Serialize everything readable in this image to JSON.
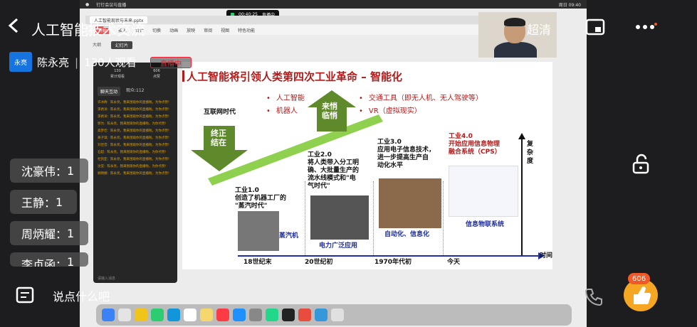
{
  "header": {
    "title": "人工智能技术交流",
    "quality": "超清"
  },
  "host": {
    "avatar_text": "永亮",
    "name": "陈永亮",
    "viewers": "130人观看",
    "live_badge": "直播中"
  },
  "ranking": [
    {
      "name": "沈豪伟",
      "count": "1"
    },
    {
      "name": "王静",
      "count": "1"
    },
    {
      "name": "周炳耀",
      "count": "1"
    },
    {
      "name": "李贞函",
      "count": "1"
    }
  ],
  "bottom": {
    "say_placeholder": "说点什么吧",
    "like_count": "606"
  },
  "mac": {
    "app_name": "钉钉会议与直播",
    "clock": "周日 09:40",
    "rec_time": "00:40:25",
    "rec_label": "直播中",
    "ppt_file": "人工智能现状与未来.pptx",
    "ribbon": [
      "开始",
      "插入",
      "设计",
      "切换",
      "动画",
      "放映",
      "审阅",
      "视图",
      "特色功能"
    ],
    "subbar": [
      "大纲",
      "幻灯片"
    ]
  },
  "panel": {
    "stat1_value": "130",
    "stat1_label": "累计观看",
    "stat2_value": "606",
    "stat2_label": "点赞",
    "tab1": "聊天互动",
    "tab2": "观众:112",
    "messages": [
      "许冰倩：陈永亮，我来围观你的直播啦，为你点赞!",
      "李君洋：陈永亮，我来围观你的直播啦，为你点赞!",
      "李君洋：陈永亮，我来围观你的直播啦，为你点赞!",
      "郭为：陈永亮，我来围观你的直播啦，为你点赞!",
      "高梦佳：陈永亮，我来围观你的直播啦，为你点赞!",
      "黄子琪：陈永亮，我来围观你的直播啦，为你点赞!",
      "刘佳音：陈永亮，我来围观你的直播啦，为你点赞!",
      "石超：陈永亮，我来围观你的直播啦，为你点赞!",
      "杜凯亚：陈永亮，我来围观你的直播啦，为你点赞!",
      "沈莹：陈永亮，我来围观你的直播啦，为你点赞!",
      "顾明娜：陈永亮，我来围观你的直播啦，为你点赞!"
    ],
    "input_placeholder": "请输入消息"
  },
  "slide": {
    "title": "人工智能将引领人类第四次工业革命 – 智能化",
    "bullets_left": [
      "人工智能",
      "机器人"
    ],
    "bullets_right": [
      "交通工具（即无人机、无人驾驶等）",
      "VR（虚拟现实）"
    ],
    "internet_era": "互联网时代",
    "end_label": "终正\n结在",
    "rise_label": "来悄\n临悄",
    "ind1": "工业1.0\n创造了机器工厂的\n\"蒸汽时代\"",
    "ind2": "工业2.0\n将人类带入分工明\n确、大批量生产的\n流水线模式和\"电\n气时代\"",
    "ind3": "工业3.0\n应用电子信息技术，\n进一步提高生产自\n动化水平",
    "ind4": "工业4.0\n开始应用信息物理\n融合系统（CPS）",
    "cap1": "蒸汽机",
    "cap2": "电力广泛应用",
    "cap3": "自动化、信息化",
    "cap4": "信息物联系统",
    "era1": "18世纪末",
    "era2": "20世纪初",
    "era3": "1970年代初",
    "era4": "今天",
    "x_axis": "时间",
    "y_axis": "复\n杂\n度"
  },
  "colors": {
    "accent": "#b01c1c",
    "blue": "#1f2f9a",
    "green": "#8fd14f"
  }
}
